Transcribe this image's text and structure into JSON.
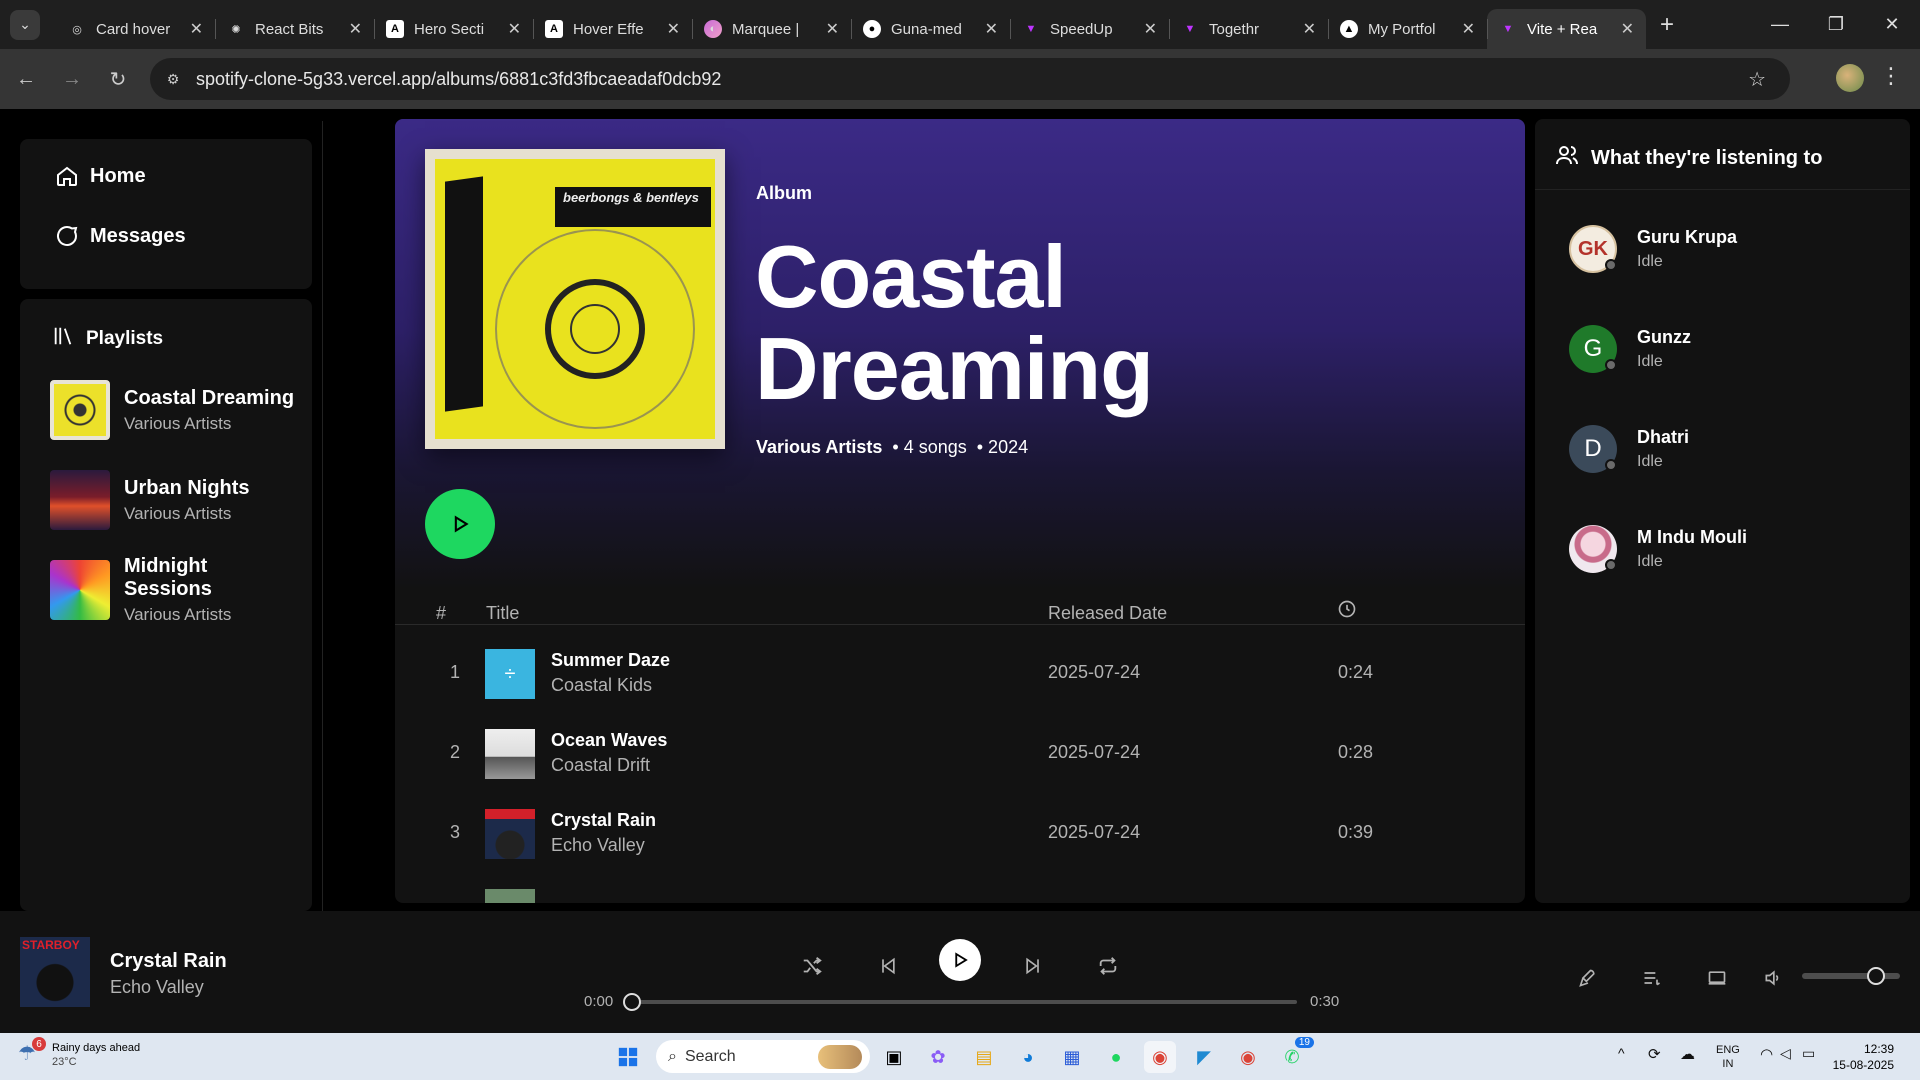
{
  "browser": {
    "tabs": [
      {
        "label": "Card hover",
        "icon": "openai-icon",
        "active": false
      },
      {
        "label": "React Bits",
        "icon": "reactbits-icon",
        "active": false
      },
      {
        "label": "Hero Secti",
        "icon": "aceternity-icon",
        "active": false
      },
      {
        "label": "Hover Effe",
        "icon": "aceternity-icon",
        "active": false
      },
      {
        "label": "Marquee |",
        "icon": "marquee-icon",
        "active": false
      },
      {
        "label": "Guna-med",
        "icon": "github-icon",
        "active": false
      },
      {
        "label": "SpeedUp",
        "icon": "vite-icon",
        "active": false
      },
      {
        "label": "Togethr",
        "icon": "vite-icon",
        "active": false
      },
      {
        "label": "My Portfol",
        "icon": "vercel-icon",
        "active": false
      },
      {
        "label": "Vite + Rea",
        "icon": "vite-icon",
        "active": true
      }
    ],
    "url": "spotify-clone-5g33.vercel.app/albums/6881c3fd3fbcaeadaf0dcb92"
  },
  "sidebar": {
    "nav": [
      {
        "label": "Home",
        "icon": "home-icon"
      },
      {
        "label": "Messages",
        "icon": "message-icon"
      }
    ],
    "playlists_heading": "Playlists",
    "playlists": [
      {
        "title": "Coastal Dreaming",
        "subtitle": "Various Artists"
      },
      {
        "title": "Urban Nights",
        "subtitle": "Various Artists"
      },
      {
        "title": "Midnight Sessions",
        "subtitle": "Various Artists"
      }
    ]
  },
  "album": {
    "type": "Album",
    "title_line1": "Coastal",
    "title_line2": "Dreaming",
    "artist": "Various Artists",
    "songs": "• 4 songs",
    "year": "• 2024",
    "cover_text": "beerbongs & bentleys"
  },
  "table": {
    "col_num": "#",
    "col_title": "Title",
    "col_date": "Released Date",
    "col_duration_icon": "clock-icon",
    "rows": [
      {
        "num": "1",
        "title": "Summer Daze",
        "artist": "Coastal Kids",
        "date": "2025-07-24",
        "duration": "0:24"
      },
      {
        "num": "2",
        "title": "Ocean Waves",
        "artist": "Coastal Drift",
        "date": "2025-07-24",
        "duration": "0:28"
      },
      {
        "num": "3",
        "title": "Crystal Rain",
        "artist": "Echo Valley",
        "date": "2025-07-24",
        "duration": "0:39"
      }
    ]
  },
  "friends": {
    "heading": "What they're listening to",
    "list": [
      {
        "name": "Guru Krupa",
        "status": "Idle",
        "initials": "GK"
      },
      {
        "name": "Gunzz",
        "status": "Idle",
        "initials": "G"
      },
      {
        "name": "Dhatri",
        "status": "Idle",
        "initials": "D"
      },
      {
        "name": "M Indu Mouli",
        "status": "Idle",
        "initials": ""
      }
    ]
  },
  "player": {
    "title": "Crystal Rain",
    "artist": "Echo Valley",
    "time_current": "0:00",
    "time_total": "0:30",
    "progress": 0.0,
    "volume": 0.75,
    "thumb_text": "STARBOY"
  },
  "taskbar": {
    "weather_badge": "6",
    "weather_line1": "Rainy days ahead",
    "weather_line2": "23°C",
    "search_placeholder": "Search",
    "whatsapp_badge": "19",
    "lang_line1": "ENG",
    "lang_line2": "IN",
    "time": "12:39",
    "date": "15-08-2025"
  },
  "colors": {
    "accent_green": "#1ed760",
    "hero_purple": "#3b2a86",
    "panel": "#121212"
  }
}
